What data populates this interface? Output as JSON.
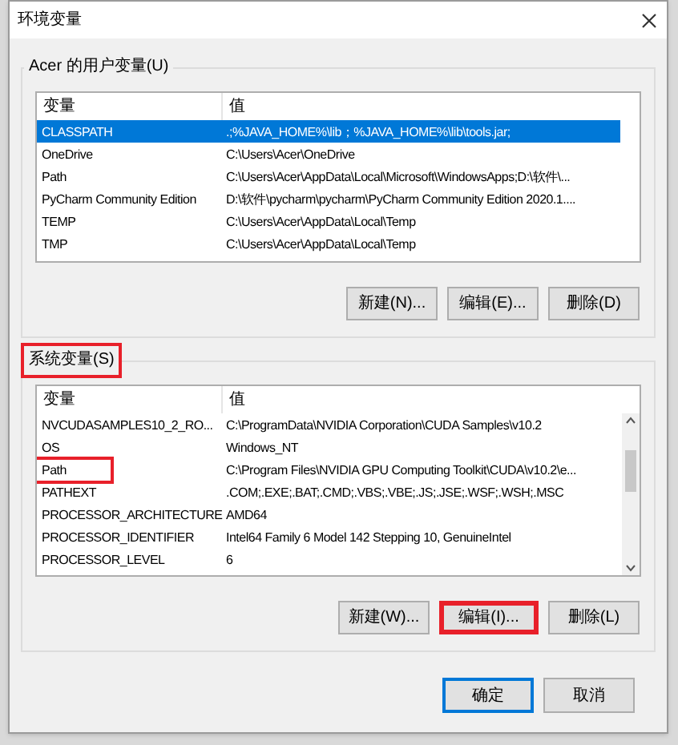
{
  "window": {
    "title": "环境变量"
  },
  "user_vars": {
    "title": "Acer 的用户变量(U)",
    "columns": [
      "变量",
      "值"
    ],
    "rows": [
      {
        "name": "CLASSPATH",
        "value": ".;%JAVA_HOME%\\lib；%JAVA_HOME%\\lib\\tools.jar;",
        "selected": true,
        "highlighted": false
      },
      {
        "name": "OneDrive",
        "value": "C:\\Users\\Acer\\OneDrive",
        "selected": false,
        "highlighted": false
      },
      {
        "name": "Path",
        "value": "C:\\Users\\Acer\\AppData\\Local\\Microsoft\\WindowsApps;D:\\软件\\...",
        "selected": false,
        "highlighted": false
      },
      {
        "name": "PyCharm Community Edition",
        "value": "D:\\软件\\pycharm\\pycharm\\PyCharm Community Edition 2020.1....",
        "selected": false,
        "highlighted": false
      },
      {
        "name": "TEMP",
        "value": "C:\\Users\\Acer\\AppData\\Local\\Temp",
        "selected": false,
        "highlighted": false
      },
      {
        "name": "TMP",
        "value": "C:\\Users\\Acer\\AppData\\Local\\Temp",
        "selected": false,
        "highlighted": false
      }
    ],
    "buttons": [
      {
        "label": "新建(N)...",
        "highlighted": false
      },
      {
        "label": "编辑(E)...",
        "highlighted": false
      },
      {
        "label": "删除(D)",
        "highlighted": false
      }
    ]
  },
  "system_vars": {
    "title": "系统变量(S)",
    "title_highlighted": true,
    "columns": [
      "变量",
      "值"
    ],
    "rows": [
      {
        "name": "NVCUDASAMPLES10_2_RO...",
        "value": "C:\\ProgramData\\NVIDIA Corporation\\CUDA Samples\\v10.2",
        "selected": false,
        "highlighted": false
      },
      {
        "name": "OS",
        "value": "Windows_NT",
        "selected": false,
        "highlighted": false
      },
      {
        "name": "Path",
        "value": "C:\\Program Files\\NVIDIA GPU Computing Toolkit\\CUDA\\v10.2\\e...",
        "selected": false,
        "highlighted": true
      },
      {
        "name": "PATHEXT",
        "value": ".COM;.EXE;.BAT;.CMD;.VBS;.VBE;.JS;.JSE;.WSF;.WSH;.MSC",
        "selected": false,
        "highlighted": false
      },
      {
        "name": "PROCESSOR_ARCHITECTURE",
        "value": "AMD64",
        "selected": false,
        "highlighted": false
      },
      {
        "name": "PROCESSOR_IDENTIFIER",
        "value": "Intel64 Family 6 Model 142 Stepping 10, GenuineIntel",
        "selected": false,
        "highlighted": false
      },
      {
        "name": "PROCESSOR_LEVEL",
        "value": "6",
        "selected": false,
        "highlighted": false
      }
    ],
    "buttons": [
      {
        "label": "新建(W)...",
        "highlighted": false
      },
      {
        "label": "编辑(I)...",
        "highlighted": true
      },
      {
        "label": "删除(L)",
        "highlighted": false
      }
    ]
  },
  "footer_buttons": [
    {
      "label": "确定",
      "default": true
    },
    {
      "label": "取消",
      "default": false
    }
  ]
}
